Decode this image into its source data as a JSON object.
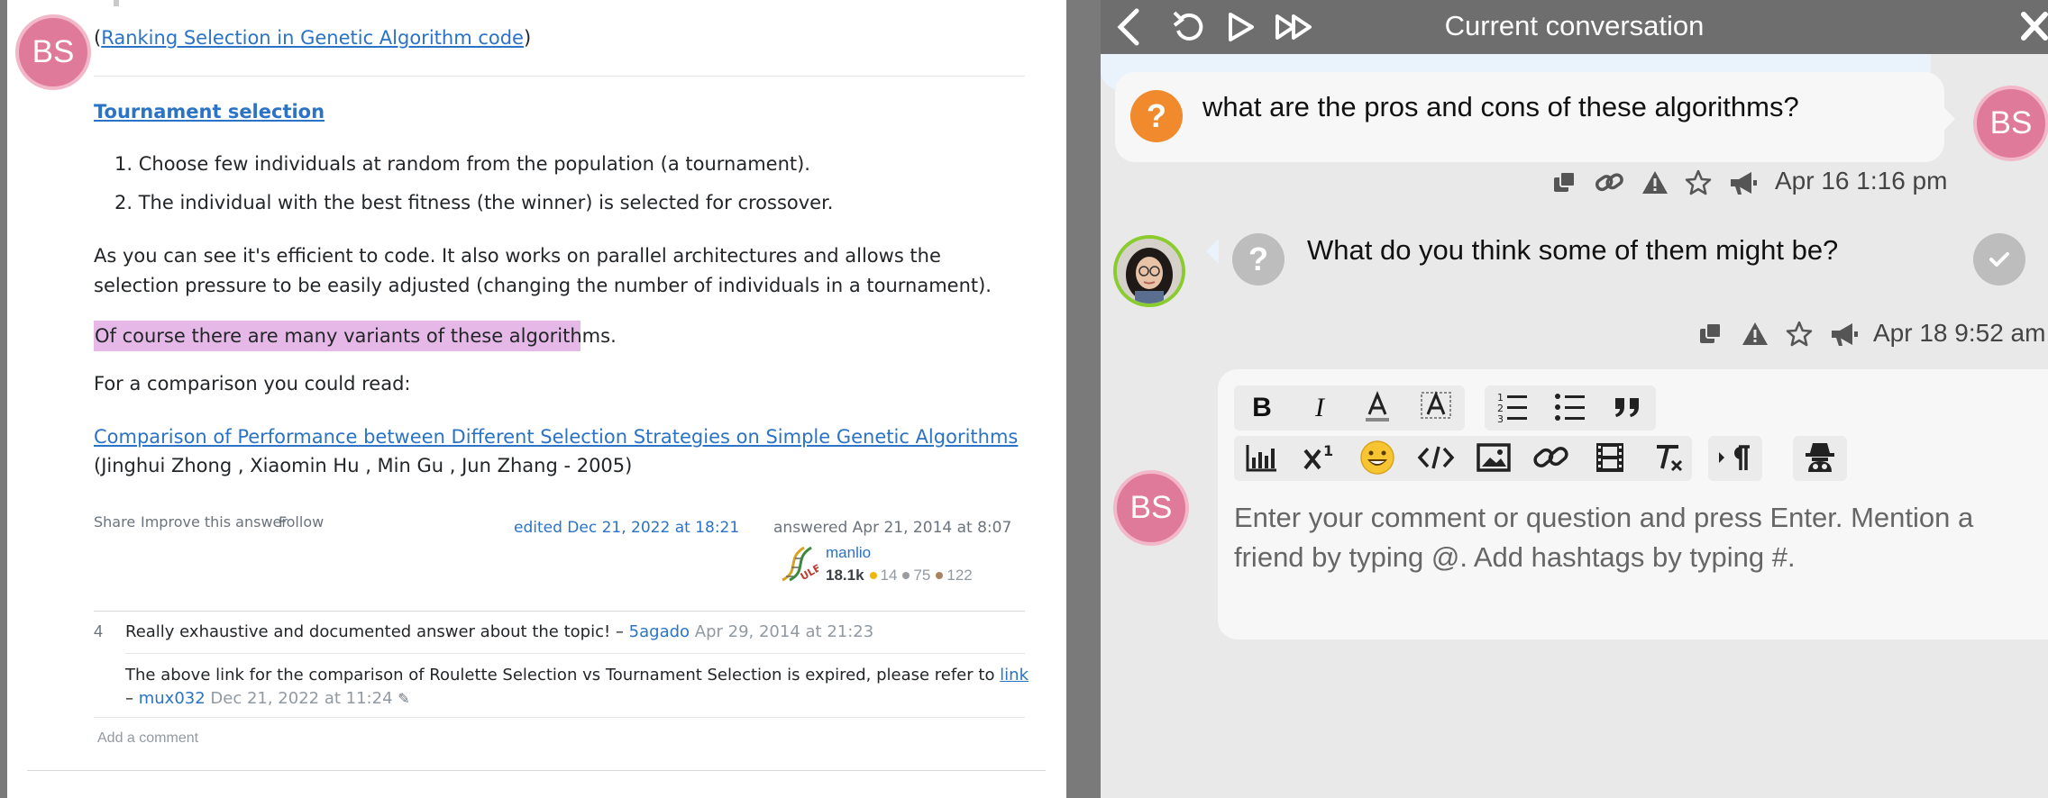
{
  "left": {
    "avatar_initials": "BS",
    "ranking_link": "Ranking Selection in Genetic Algorithm code",
    "tournament_heading": "Tournament selection",
    "list": [
      "Choose few individuals at random from the population (a tournament).",
      "The individual with the best fitness (the winner) is selected for crossover."
    ],
    "paragraph1": "As you can see it's efficient to code. It also works on parallel architectures and allows the selection pressure to be easily adjusted (changing the number of individuals in a tournament).",
    "highlight": "Of course there are many variants of these algorithms.",
    "paragraph3": "For a comparison you could read:",
    "comparison_link": "Comparison of Performance between Different Selection Strategies on Simple Genetic Algorithms",
    "comparison_authors": " (Jinghui Zhong , Xiaomin Hu , Min Gu , Jun Zhang - 2005)",
    "share": "Share",
    "improve": "Improve this answer",
    "follow": "Follow",
    "edited": "edited Dec 21, 2022 at 18:21",
    "answered": "answered Apr 21, 2014 at 8:07",
    "user": {
      "name": "manlio",
      "rep": "18.1k",
      "gold": "14",
      "silver": "75",
      "bronze": "122",
      "gold_color": "#f1b600",
      "silver_color": "#9a9c9f",
      "bronze_color": "#ab825f"
    },
    "comments": [
      {
        "score": "4",
        "text": "Really exhaustive and documented answer about the topic! – ",
        "author": "5agado",
        "date": " Apr 29, 2014 at 21:23"
      },
      {
        "text_line1": "The above link for the comparison of Roulette Selection vs Tournament Selection is expired, please refer to ",
        "link": "link",
        "dash": "– ",
        "author": "mux032",
        "date": " Dec 21, 2022 at 11:24"
      }
    ],
    "add_comment": "Add a comment"
  },
  "right": {
    "title": "Current conversation",
    "messages": [
      {
        "text": "what are the pros and cons of these algorithms?",
        "avatar_initials": "BS",
        "icon": "?",
        "timestamp": "Apr 16 1:16 pm"
      },
      {
        "text": "What do you think some of them might be?",
        "icon": "?",
        "timestamp": "Apr 18 9:52 am"
      }
    ],
    "composer": {
      "avatar_initials": "BS",
      "placeholder": "Enter your comment or question and press Enter. Mention a friend by typing @. Add hashtags by typing #."
    },
    "colors": {
      "topbar": "#6e6e6e",
      "question_orange": "#f08a2c",
      "avatar_pink": "#e07a9b",
      "link_blue": "#2a73c6",
      "highlight": "#e6b8e8"
    }
  }
}
